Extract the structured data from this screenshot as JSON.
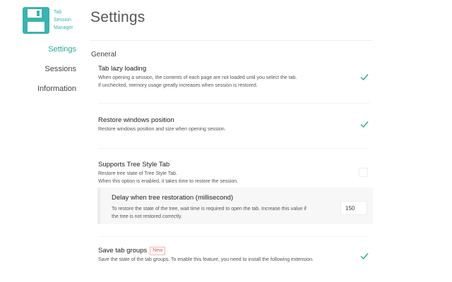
{
  "app": {
    "logo_lines": [
      "Tab",
      "Session",
      "Manager"
    ],
    "accent_color": "#27a98f",
    "logo_color": "#3bb3b0",
    "logo_icon": "floppy-disk-icon"
  },
  "sidebar": {
    "items": [
      {
        "label": "Settings",
        "active": true
      },
      {
        "label": "Sessions",
        "active": false
      },
      {
        "label": "Information",
        "active": false
      }
    ]
  },
  "main": {
    "title": "Settings",
    "section": "General",
    "options": [
      {
        "title": "Tab lazy loading",
        "desc1": "When opening a session, the contents of each page are not loaded until you select the tab.",
        "desc2": "If unchecked, memory usage greatly increases when session is restored.",
        "checked": true
      },
      {
        "title": "Restore windows position",
        "desc1": "Restore windows position and size when opening session.",
        "checked": true
      },
      {
        "title": "Supports Tree Style Tab",
        "desc1": "Restore tree state of Tree Style Tab.",
        "desc2": "When this option is enabled, it takes time to restore the session.",
        "checked": false,
        "sub": {
          "title": "Delay when tree restoration (millisecond)",
          "desc1": "To restore the state of the tree, wait time is required to open the tab. Increase this value if",
          "desc2": "the tree is not restored correctly.",
          "value": "150"
        }
      },
      {
        "title": "Save tab groups",
        "badge": "New",
        "desc1": "Save the state of the tab groups. To enable this feature, you need to install the following extension.",
        "checked": true
      }
    ]
  }
}
